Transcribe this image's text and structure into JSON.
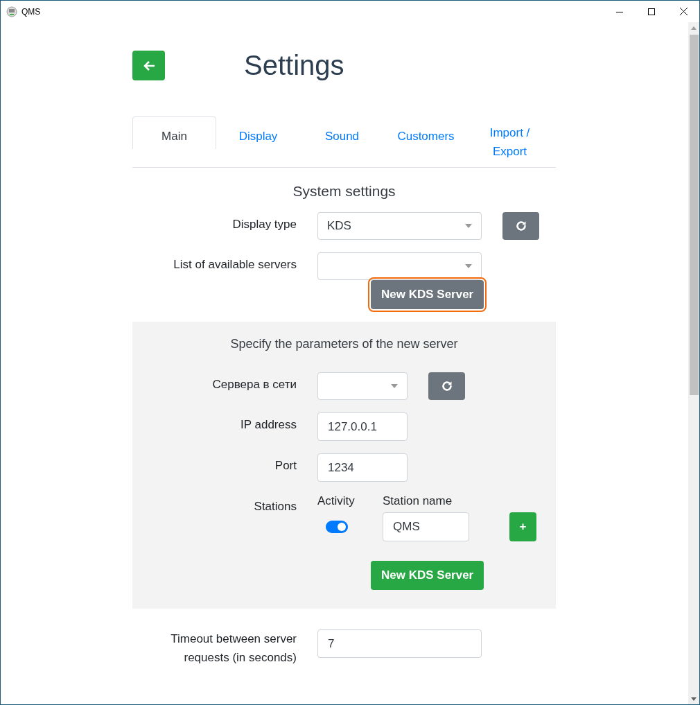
{
  "window": {
    "title": "QMS"
  },
  "page": {
    "title": "Settings"
  },
  "tabs": [
    {
      "label": "Main",
      "selected": true
    },
    {
      "label": "Display",
      "selected": false
    },
    {
      "label": "Sound",
      "selected": false
    },
    {
      "label": "Customers",
      "selected": false
    },
    {
      "label": "Import / Export",
      "selected": false
    }
  ],
  "system_settings": {
    "heading": "System settings",
    "fields": [
      {
        "label": "Display type",
        "kind": "select",
        "value": "KDS",
        "refresh": true
      },
      {
        "label": "List of available servers",
        "kind": "select",
        "refresh": false
      }
    ],
    "new_server_button": {
      "label": "New KDS Server",
      "focused": true
    }
  },
  "new_server": {
    "heading": "Specify the parameters of the new server",
    "fields": [
      {
        "label": "Сервера в сети",
        "kind": "select",
        "refresh": true
      },
      {
        "label": "IP address",
        "kind": "input",
        "value": "127.0.0.1"
      },
      {
        "label": "Port",
        "kind": "input",
        "value": "1234"
      }
    ],
    "stations": {
      "label": "Stations",
      "activity_header": "Activity",
      "name_header": "Station name",
      "rows": [
        {
          "active": true,
          "name": "QMS"
        }
      ],
      "add_button": "+"
    },
    "submit_button": "New KDS Server"
  },
  "timeout": {
    "label": "Timeout between server requests (in seconds)",
    "value": "7"
  }
}
